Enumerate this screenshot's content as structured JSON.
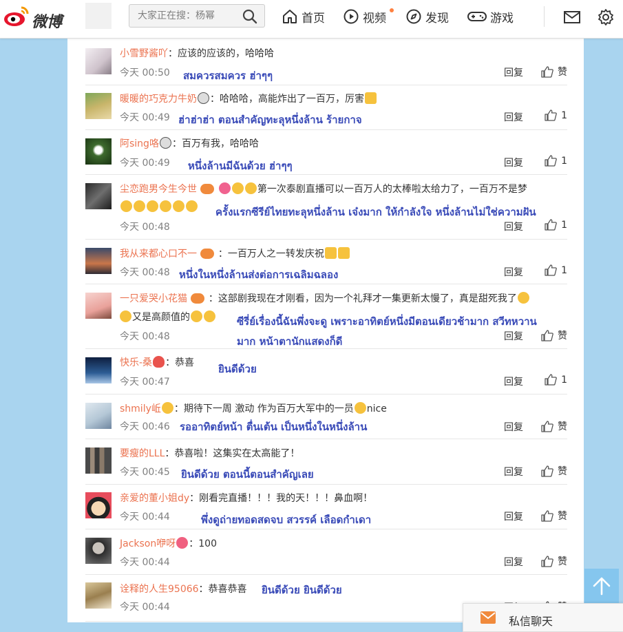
{
  "header": {
    "logo_text": "微博",
    "search_placeholder": "大家正在搜：杨幂",
    "nav": [
      {
        "label": "首页",
        "icon": "home-icon"
      },
      {
        "label": "视频",
        "icon": "video-icon"
      },
      {
        "label": "发现",
        "icon": "compass-icon"
      },
      {
        "label": "游戏",
        "icon": "gamepad-icon"
      }
    ],
    "colors": {
      "accent": "#eb7350",
      "translation": "#3a4bb8",
      "background": "#a9d4ef",
      "badge": "#ff8140"
    }
  },
  "comments": [
    {
      "user": "小雪野酱吖",
      "text": "：应该的应该的，哈哈哈",
      "time": "今天 00:50",
      "translation": "สมควรสมควร ฮ่าๆๆ",
      "reply": "回复",
      "likes": "赞"
    },
    {
      "user": "暖暖的巧克力牛奶",
      "text": "：哈哈哈，高能炸出了一百万，厉害",
      "time": "今天 00:49",
      "translation": "ฮ่าฮ่าฮ่า ตอนสำคัญทะลุหนึ่งล้าน ร้ายกาจ",
      "reply": "回复",
      "likes": "1"
    },
    {
      "user": "阿sing咯",
      "text": "：百万有我，哈哈哈",
      "time": "今天 00:49",
      "translation": "หนึ่งล้านมีฉันด้วย ฮ่าๆๆ",
      "reply": "回复",
      "likes": "1"
    },
    {
      "user": "尘恋跑男今生今世",
      "text": "第一次泰剧直播可以一百万人的太棒啦太给力了，一百万不是梦",
      "time": "今天 00:48",
      "translation": "ครั้งแรกซีรีย์ไทยทะลุหนึ่งล้าน เจ๋งมาก ให้กำลังใจ หนึ่งล้านไม่ใช่ความฝัน",
      "reply": "回复",
      "likes": "1"
    },
    {
      "user": "我从来都心口不一",
      "text": "：一百万人之一转发庆祝",
      "time": "今天 00:48",
      "translation": "หนึ่งในหนึ่งล้านส่งต่อการเฉลิมฉลอง",
      "reply": "回复",
      "likes": "1"
    },
    {
      "user": "一只爱哭小花猫",
      "text": "：这部剧我现在才刚看，因为一个礼拜才一集更新太慢了，真是甜死我了",
      "text2": "又是高颜值的",
      "time": "今天 00:48",
      "translation": "ซีรี่ย์เรื่องนี้ฉันพึ่งจะดู  เพราะอาทิตย์หนึ่งมีตอนเดียวช้ามาก สวีทหวาน",
      "translation2": "มาก หน้าตานักแสดงก็ดี",
      "reply": "回复",
      "likes": "赞"
    },
    {
      "user": "快乐-桑",
      "text": "：恭喜",
      "time": "今天 00:47",
      "translation": "ยินดีด้วย",
      "reply": "回复",
      "likes": "1"
    },
    {
      "user": "shmily岴",
      "text": "：期待下一周 激动  作为百万大军中的一员",
      "text_tail": "nice",
      "time": "今天 00:46",
      "translation": "รออาทิตย์หน้า ตื่นเต้น  เป็นหนึ่งในหนึ่งล้าน",
      "reply": "回复",
      "likes": "赞"
    },
    {
      "user": "要瘦的LLL",
      "text": "：恭喜啦！这集实在太高能了！",
      "time": "今天 00:45",
      "translation": "ยินดีด้วย ตอนนี้ตอนสำคัญเลย",
      "reply": "回复",
      "likes": "赞"
    },
    {
      "user": "亲爱的董小姐dy",
      "text": "：刚看完直播！！！我的天！！！鼻血啊！",
      "time": "今天 00:44",
      "translation": "พึ่งดูถ่ายทอดสดจบ  สวรรค์  เลือดกำเดา",
      "reply": "回复",
      "likes": "赞"
    },
    {
      "user": "Jackson咿呀",
      "text": "：100",
      "time": "今天 00:44",
      "reply": "回复",
      "likes": "赞"
    },
    {
      "user": "诠释的人生95066",
      "text": "：恭喜恭喜",
      "time": "今天 00:44",
      "translation": "ยินดีด้วย ยินดีด้วย",
      "reply": "回复",
      "likes": "赞"
    }
  ],
  "chat": {
    "label": "私信聊天"
  }
}
